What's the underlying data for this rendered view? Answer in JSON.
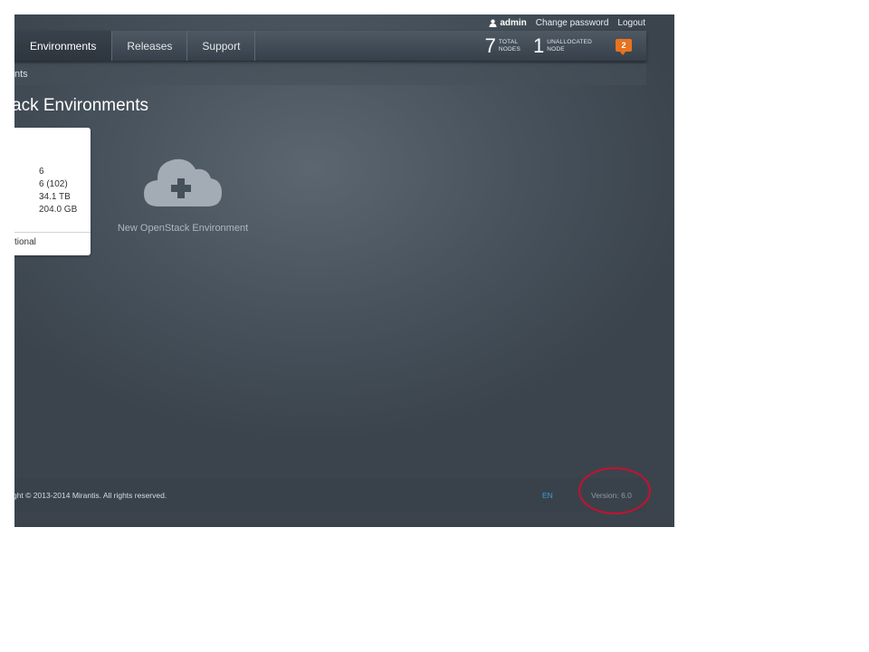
{
  "userbar": {
    "username": "admin",
    "change_password": "Change password",
    "logout": "Logout"
  },
  "nav": {
    "tabs": [
      {
        "label": "Environments",
        "active": true
      },
      {
        "label": "Releases",
        "active": false
      },
      {
        "label": "Support",
        "active": false
      }
    ],
    "total_nodes": {
      "value": "7",
      "label_line1": "TOTAL",
      "label_line2": "NODES"
    },
    "unallocated_nodes": {
      "value": "1",
      "label_line1": "UNALLOCATED",
      "label_line2": "NODE"
    },
    "notifications_count": "2"
  },
  "breadcrumb": "nts",
  "page_title": "ack Environments",
  "env_card": {
    "values": [
      "6",
      "6 (102)",
      "34.1 TB",
      "204.0 GB"
    ],
    "status": "tional"
  },
  "new_env": {
    "label": "New OpenStack Environment"
  },
  "footer": {
    "copyright": "ght © 2013-2014 Mirantis. All rights reserved.",
    "language": "EN",
    "version": "Version: 6.0"
  },
  "colors": {
    "notification": "#e8731f",
    "annotation_ring": "#c8102e",
    "language_link": "#3e9bd6"
  }
}
